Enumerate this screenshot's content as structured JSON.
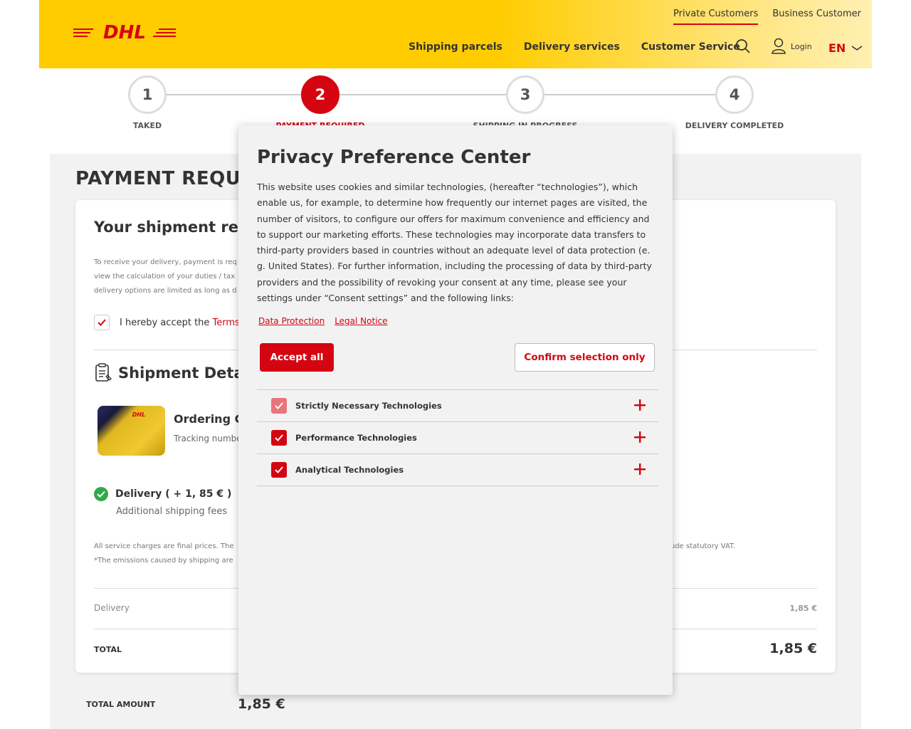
{
  "header": {
    "logo_text": "DHL",
    "top_links": [
      {
        "label": "Private Customers",
        "active": true
      },
      {
        "label": "Business Customer",
        "active": false
      }
    ],
    "nav": [
      "Shipping parcels",
      "Delivery services",
      "Customer Service"
    ],
    "login_label": "Login",
    "lang_label": "EN"
  },
  "stepper": {
    "steps": [
      {
        "num": "1",
        "label": "TAKED"
      },
      {
        "num": "2",
        "label": "PAYMENT REQUIRED"
      },
      {
        "num": "3",
        "label": "SHIPPING IN PROGRESS"
      },
      {
        "num": "4",
        "label": "DELIVERY COMPLETED"
      }
    ],
    "active_step": 2
  },
  "page": {
    "heading": "PAYMENT REQUIR",
    "card_title": "Your shipment requ",
    "para_lines": [
      "To receive your delivery, payment is req",
      "view the calculation of your duties / tax",
      "delivery options are limited as long as d"
    ],
    "accept_text": "I hereby accept the ",
    "accept_link": "Terms &",
    "shipment_title": "Shipment Detail",
    "ordering": "Ordering CP",
    "tracking": "Tracking numbe",
    "delivery_label": "Delivery ( + 1, 85 € )",
    "additional_fees": "Additional shipping fees",
    "fine_print_1": "All service charges are final prices. The",
    "fine_print_1b": "ude statutory VAT.",
    "fine_print_2": "*The emissions caused by shipping are",
    "row_delivery_label": "Delivery",
    "row_delivery_value": "1,85 €",
    "row_total_label": "TOTAL",
    "row_total_value": "1,85 €",
    "total_amount_label": "TOTAL AMOUNT",
    "total_amount_value": "1,85 €",
    "thumb_logo": "DHL"
  },
  "modal": {
    "title": "Privacy Preference Center",
    "body": "This website uses cookies and similar technologies, (hereafter “technologies”), which enable us, for example, to determine how frequently our internet pages are visited, the number of visitors, to configure our offers for maximum convenience and efficiency and to support our marketing efforts. These technologies may incorporate data transfers to third-party providers based in countries without an adequate level of data protection (e. g. United States). For further information, including the processing of data by third-party providers and the possibility of revoking your consent at any time, please see your settings under “Consent settings” and the following links:",
    "link_data_protection": "Data Protection",
    "link_legal_notice": "Legal Notice",
    "accept_all": "Accept all",
    "confirm_selection": "Confirm selection only",
    "technologies": [
      {
        "label": "Strictly Necessary Technologies",
        "checked": true,
        "disabled": true
      },
      {
        "label": "Performance Technologies",
        "checked": true,
        "disabled": false
      },
      {
        "label": "Analytical Technologies",
        "checked": true,
        "disabled": false
      }
    ]
  },
  "colors": {
    "brand_yellow": "#ffcc00",
    "brand_red": "#d40511",
    "success_green": "#2eaa4a"
  }
}
